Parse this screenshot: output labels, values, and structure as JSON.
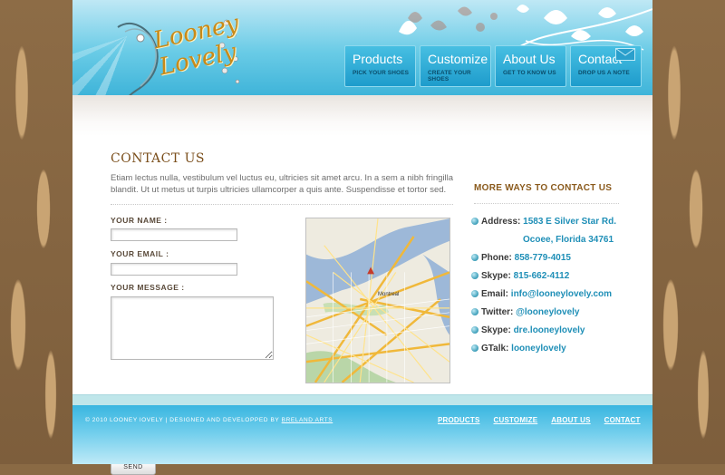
{
  "brand": {
    "logo_text": "Looney Lovely"
  },
  "nav": [
    {
      "label": "Products",
      "sub": "PICK YOUR SHOES"
    },
    {
      "label": "Customize",
      "sub": "CREATE YOUR SHOES"
    },
    {
      "label": "About Us",
      "sub": "GET TO KNOW US"
    },
    {
      "label": "Contact",
      "sub": "DROP US A NOTE"
    }
  ],
  "main": {
    "title": "CONTACT US",
    "intro": "Etiam lectus nulla, vestibulum vel luctus eu, ultricies sit amet arcu. In a sem a nibh fringilla blandit. Ut ut metus ut turpis ultricies ullamcorper a quis ante. Suspendisse et tortor sed.",
    "form": {
      "name_label": "YOUR NAME :",
      "email_label": "YOUR EMAIL :",
      "message_label": "YOUR MESSAGE :",
      "send_label": "SEND"
    },
    "map": {
      "city_label": "Montreal"
    }
  },
  "sidebar": {
    "title": "MORE WAYS TO CONTACT US",
    "contacts": [
      {
        "key": "Address:",
        "value": "1583 E Silver Star Rd."
      },
      {
        "key": "",
        "value": "Ocoee, Florida 34761"
      },
      {
        "key": "Phone:",
        "value": "858-779-4015"
      },
      {
        "key": "Skype:",
        "value": "815-662-4112"
      },
      {
        "key": "Email:",
        "value": "info@looneylovely.com"
      },
      {
        "key": "Twitter:",
        "value": "@looneylovely"
      },
      {
        "key": "Skype:",
        "value": "dre.looneylovely"
      },
      {
        "key": "GTalk:",
        "value": "looneylovely"
      }
    ]
  },
  "footer": {
    "copyright": "© 2010 LOONEY lOVELY  |  DESIGNED AND DEVELOPPED BY",
    "credit_link": "BRELAND ARTS",
    "links": [
      "PRODUCTS",
      "CUSTOMIZE",
      "ABOUT US",
      "CONTACT"
    ]
  },
  "colors": {
    "header_blue": "#3fb4d9",
    "title_brown": "#7b4f1c",
    "link_blue": "#1f8fb7",
    "background_brown": "#8a6a44"
  }
}
